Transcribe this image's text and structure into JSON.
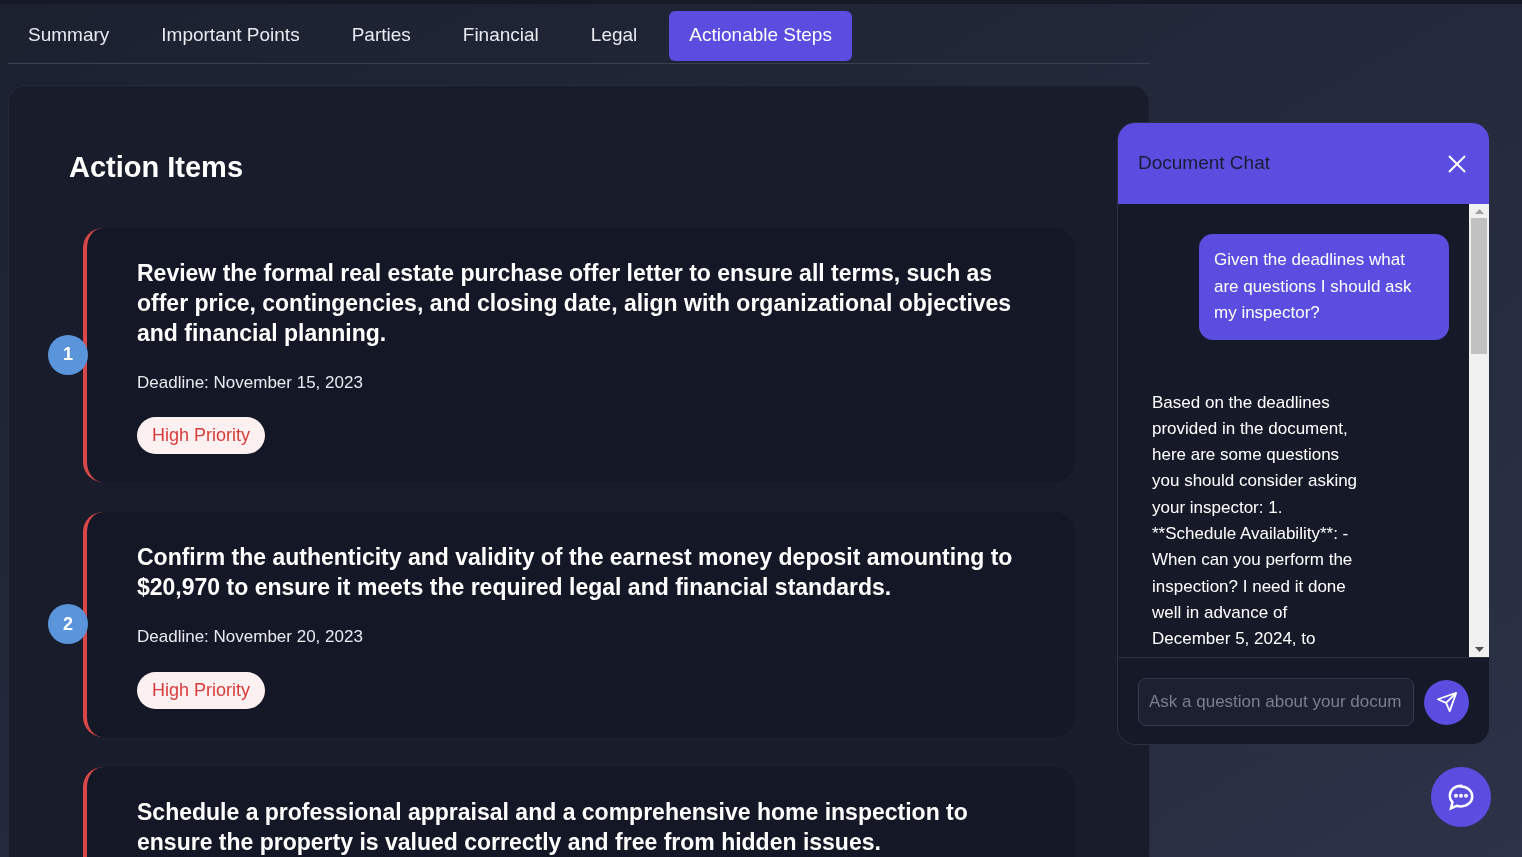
{
  "tabs": [
    {
      "label": "Summary",
      "selected": false
    },
    {
      "label": "Important Points",
      "selected": false
    },
    {
      "label": "Parties",
      "selected": false
    },
    {
      "label": "Financial",
      "selected": false
    },
    {
      "label": "Legal",
      "selected": false
    },
    {
      "label": "Actionable Steps",
      "selected": true
    }
  ],
  "section_title": "Action Items",
  "action_items": [
    {
      "number": "1",
      "title": "Review the formal real estate purchase offer letter to ensure all terms, such as offer price, contingencies, and closing date, align with organizational objectives and financial planning.",
      "deadline": "Deadline: November 15, 2023",
      "priority": {
        "kind": "high",
        "label": "High Priority"
      }
    },
    {
      "number": "2",
      "title": "Confirm the authenticity and validity of the earnest money deposit amounting to $20,970 to ensure it meets the required legal and financial standards.",
      "deadline": "Deadline: November 20, 2023",
      "priority": {
        "kind": "high",
        "label": "High Priority"
      }
    },
    {
      "title": "Schedule a professional appraisal and a comprehensive home inspection to ensure the property is valued correctly and free from hidden issues."
    }
  ],
  "chat": {
    "title": "Document Chat",
    "messages": [
      {
        "kind": "user",
        "text": "Given the deadlines what are questions I should ask my inspector?"
      },
      {
        "kind": "assistant",
        "text": "Based on the deadlines provided in the document, here are some questions you should consider asking your inspector: 1. **Schedule Availability**: - When can you perform the inspection? I need it done well in advance of December 5, 2024, to"
      }
    ],
    "input": {
      "placeholder": "Ask a question about your docum"
    }
  }
}
